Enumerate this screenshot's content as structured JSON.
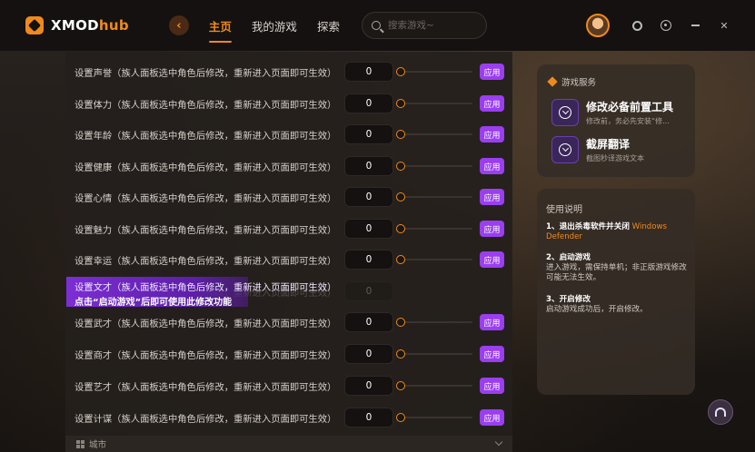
{
  "header": {
    "logo_text": "XMOD",
    "logo_suffix": "hub",
    "nav": [
      {
        "label": "主页",
        "active": true
      },
      {
        "label": "我的游戏",
        "active": false
      },
      {
        "label": "探索",
        "active": false
      }
    ],
    "search_placeholder": "搜索游戏~"
  },
  "settings": {
    "rows": [
      {
        "label": "设置声誉（族人面板选中角色后修改，重新进入页面即可生效）",
        "value": "0",
        "apply": "应用"
      },
      {
        "label": "设置体力（族人面板选中角色后修改，重新进入页面即可生效）",
        "value": "0",
        "apply": "应用"
      },
      {
        "label": "设置年龄（族人面板选中角色后修改，重新进入页面即可生效）",
        "value": "0",
        "apply": "应用"
      },
      {
        "label": "设置健康（族人面板选中角色后修改，重新进入页面即可生效）",
        "value": "0",
        "apply": "应用"
      },
      {
        "label": "设置心情（族人面板选中角色后修改，重新进入页面即可生效）",
        "value": "0",
        "apply": "应用"
      },
      {
        "label": "设置魅力（族人面板选中角色后修改，重新进入页面即可生效）",
        "value": "0",
        "apply": "应用"
      },
      {
        "label": "设置幸运（族人面板选中角色后修改，重新进入页面即可生效）",
        "value": "0",
        "apply": "应用"
      },
      {
        "label": "设置文才（族人面板选中角色后修改，重新进入页面即可生效）",
        "value": "0",
        "apply": "应用"
      },
      {
        "label": "设置武才（族人面板选中角色后修改，重新进入页面即可生效）",
        "value": "0",
        "apply": "应用"
      },
      {
        "label": "设置商才（族人面板选中角色后修改，重新进入页面即可生效）",
        "value": "0",
        "apply": "应用"
      },
      {
        "label": "设置艺才（族人面板选中角色后修改，重新进入页面即可生效）",
        "value": "0",
        "apply": "应用"
      },
      {
        "label": "设置计谋（族人面板选中角色后修改，重新进入页面即可生效）",
        "value": "0",
        "apply": "应用"
      }
    ],
    "tooltip": {
      "line1": "设置文才（族人面板选中角色后修改，重新进入页面即可生效）",
      "line2": "点击“启动游戏”后即可使用此修改功能"
    },
    "collapsed_section": "城市"
  },
  "services": {
    "title": "游戏服务",
    "items": [
      {
        "name": "修改必备前置工具",
        "sub": "修改前，务必先安装“修..."
      },
      {
        "name": "截屏翻译",
        "sub": "截图秒译游戏文本"
      }
    ]
  },
  "guide": {
    "title": "使用说明",
    "steps": [
      {
        "head": "1、退出杀毒软件并关闭",
        "highlight": "Windows Defender",
        "body": ""
      },
      {
        "head": "2、启动游戏",
        "highlight": "",
        "body": "进入游戏，需保持单机；非正版游戏修改可能无法生效。"
      },
      {
        "head": "3、开启修改",
        "highlight": "",
        "body": "启动游戏成功后，开启修改。"
      }
    ]
  },
  "colors": {
    "accent": "#f08a1c",
    "purple": "#9a3ef0"
  },
  "icons": [
    "logo-icon",
    "back-arrow-icon",
    "search-icon",
    "shirt-icon",
    "settings-icon",
    "minimize-icon",
    "close-icon",
    "download-icon",
    "headset-icon"
  ]
}
